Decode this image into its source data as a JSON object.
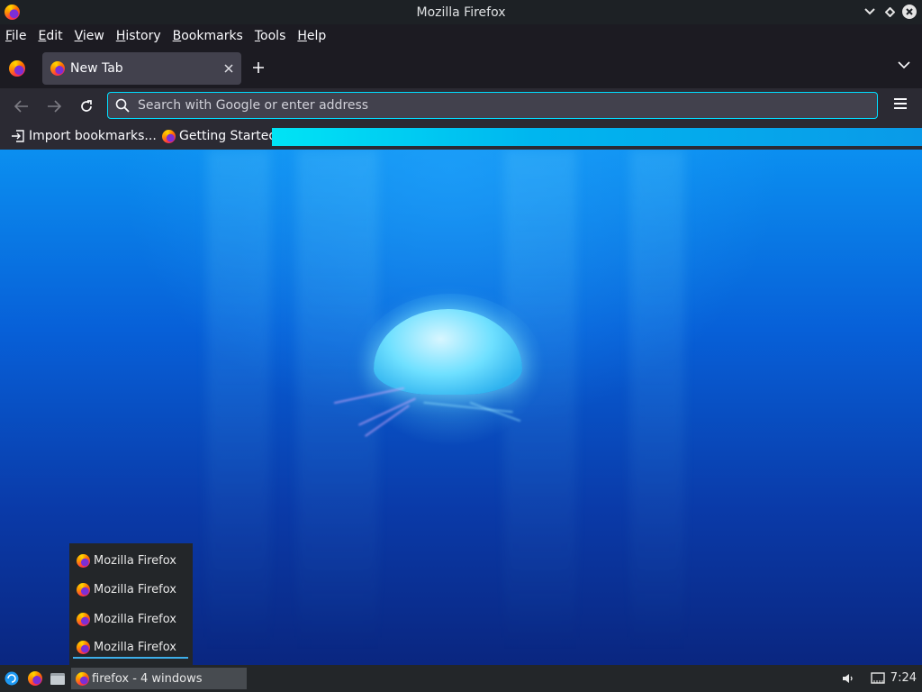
{
  "window": {
    "title": "Mozilla Firefox",
    "buttons": {
      "minimize_icon": "chevron-down-icon",
      "maximize_icon": "diamond-icon",
      "close_icon": "close-icon"
    }
  },
  "menubar": {
    "items": [
      "File",
      "Edit",
      "View",
      "History",
      "Bookmarks",
      "Tools",
      "Help"
    ],
    "mnemonics": [
      "F",
      "E",
      "V",
      "H",
      "B",
      "T",
      "H"
    ]
  },
  "tabs": {
    "items": [
      {
        "label": "New Tab",
        "active": true
      }
    ],
    "new_tab_icon": "plus-icon",
    "list_tabs_icon": "chevron-down-icon"
  },
  "navbar": {
    "back_icon": "arrow-left-icon",
    "forward_icon": "arrow-right-icon",
    "reload_icon": "reload-icon",
    "url_value": "",
    "url_placeholder": "Search with Google or enter address",
    "menu_icon": "hamburger-icon"
  },
  "bookmarks": {
    "items": [
      {
        "label": "Import bookmarks...",
        "icon": "import-icon"
      },
      {
        "label": "Getting Started",
        "icon": "firefox-icon"
      }
    ]
  },
  "colors": {
    "toolbar": "#2b2a33",
    "tabstrip": "#1c1b22",
    "accent": "#00ddff",
    "taskbar": "#232629",
    "taskbar_highlight": "#3daee9"
  },
  "task_popup": {
    "items": [
      "Mozilla Firefox",
      "Mozilla Firefox",
      "Mozilla Firefox",
      "Mozilla Firefox"
    ],
    "active_index": 3
  },
  "taskbar": {
    "launcher_icons": [
      "app-menu-icon",
      "firefox-icon",
      "file-manager-icon"
    ],
    "task_label": "firefox - 4 windows",
    "tray_icons": [
      "volume-icon",
      "network-icon"
    ],
    "clock": "7:24"
  }
}
